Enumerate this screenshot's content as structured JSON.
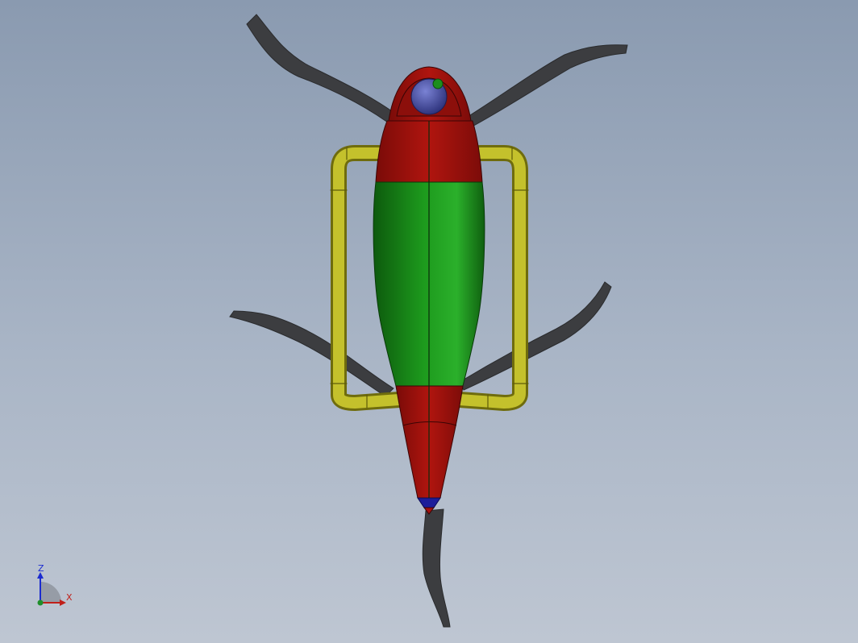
{
  "scene": {
    "background_top": "#8a9ab0",
    "background_bottom": "#bec6d2",
    "colors": {
      "legs": "#3c3d40",
      "head_and_tail": "#a5120f",
      "body": "#1c8e1c",
      "frame": "#b5b320",
      "eye": "#4b53a8",
      "sensor": "#1c8e1c",
      "tail_tip": "#1d1d9a"
    }
  },
  "triad": {
    "z_label": "Z",
    "x_label": "X",
    "z_color": "#1b2bd0",
    "x_color": "#c0201a"
  }
}
